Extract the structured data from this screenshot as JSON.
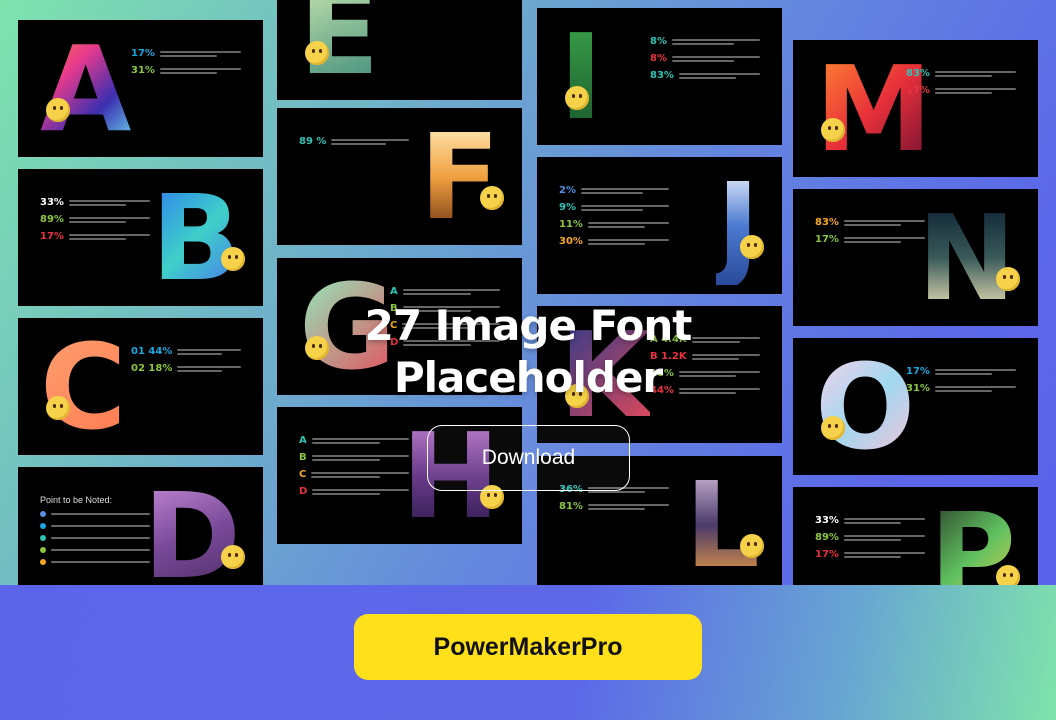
{
  "hero": {
    "title_line1": "27 Image Font",
    "title_line2": "Placeholder",
    "download_label": "Download"
  },
  "footer": {
    "brand_label": "PowerMakerPro"
  },
  "colors": {
    "brand_button": "#ffe01b",
    "teal": "#2ec4b6",
    "green": "#8cc63f",
    "red": "#e8333f",
    "orange": "#f7a823",
    "blue": "#1aa6e0"
  },
  "slides": [
    {
      "letter": "A",
      "stats": [
        {
          "v": "17%",
          "c": "#1aa6e0"
        },
        {
          "v": "31%",
          "c": "#8cc63f"
        }
      ]
    },
    {
      "letter": "B",
      "stats": [
        {
          "v": "33%",
          "c": "#ffffff"
        },
        {
          "v": "89%",
          "c": "#8cc63f"
        },
        {
          "v": "17%",
          "c": "#e8333f"
        }
      ]
    },
    {
      "letter": "C",
      "stats": [
        {
          "v": "01 44%",
          "c": "#1aa6e0"
        },
        {
          "v": "02 18%",
          "c": "#8cc63f"
        }
      ]
    },
    {
      "letter": "D",
      "heading": "Point to be Noted:",
      "stats": []
    },
    {
      "letter": "E",
      "stats": [
        {
          "v": "%",
          "c": "#f7a823"
        }
      ]
    },
    {
      "letter": "F",
      "stats": [
        {
          "v": "89 %",
          "c": "#2ec4b6"
        }
      ]
    },
    {
      "letter": "G",
      "stats": [
        {
          "v": "A",
          "c": "#2ec4b6"
        },
        {
          "v": "B",
          "c": "#8cc63f"
        },
        {
          "v": "C",
          "c": "#f7a823"
        },
        {
          "v": "D",
          "c": "#e8333f"
        }
      ]
    },
    {
      "letter": "H",
      "stats": [
        {
          "v": "A",
          "c": "#2ec4b6"
        },
        {
          "v": "B",
          "c": "#8cc63f"
        },
        {
          "v": "C",
          "c": "#f7a823"
        },
        {
          "v": "D",
          "c": "#e8333f"
        }
      ]
    },
    {
      "letter": "I",
      "stats": [
        {
          "v": "8%",
          "c": "#2ec4b6"
        },
        {
          "v": "8%",
          "c": "#e8333f"
        },
        {
          "v": "83%",
          "c": "#2ec4b6"
        }
      ]
    },
    {
      "letter": "J",
      "stats": [
        {
          "v": "2%",
          "c": "#4f8fe0"
        },
        {
          "v": "9%",
          "c": "#2ec4b6"
        },
        {
          "v": "11%",
          "c": "#8cc63f"
        },
        {
          "v": "30%",
          "c": "#f7a823"
        }
      ]
    },
    {
      "letter": "K",
      "stats": [
        {
          "v": "A 4.4K",
          "c": "#8cc63f"
        },
        {
          "v": "B 1.2K",
          "c": "#e8333f"
        },
        {
          "v": "18%",
          "c": "#8cc63f"
        },
        {
          "v": "44%",
          "c": "#e8333f"
        }
      ]
    },
    {
      "letter": "L",
      "stats": [
        {
          "v": "36%",
          "c": "#2ec4b6"
        },
        {
          "v": "81%",
          "c": "#8cc63f"
        }
      ]
    },
    {
      "letter": "M",
      "stats": [
        {
          "v": "83%",
          "c": "#2ec4b6"
        },
        {
          "v": "17%",
          "c": "#e8333f"
        }
      ]
    },
    {
      "letter": "N",
      "stats": [
        {
          "v": "83%",
          "c": "#f7a823"
        },
        {
          "v": "17%",
          "c": "#8cc63f"
        }
      ]
    },
    {
      "letter": "O",
      "stats": [
        {
          "v": "17%",
          "c": "#1aa6e0"
        },
        {
          "v": "31%",
          "c": "#8cc63f"
        }
      ]
    },
    {
      "letter": "P",
      "stats": [
        {
          "v": "33%",
          "c": "#ffffff"
        },
        {
          "v": "89%",
          "c": "#8cc63f"
        },
        {
          "v": "17%",
          "c": "#e8333f"
        }
      ]
    }
  ]
}
